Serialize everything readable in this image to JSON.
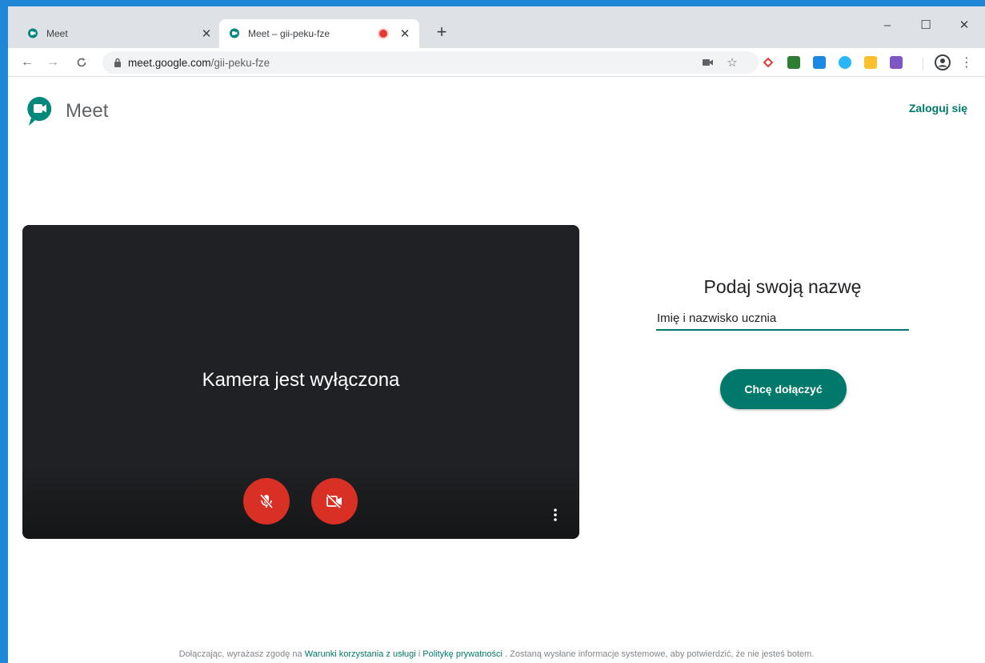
{
  "browser": {
    "tabs": [
      {
        "title": "Meet",
        "active": false
      },
      {
        "title": "Meet – gii-peku-fze",
        "active": true
      }
    ],
    "address": {
      "host": "meet.google.com",
      "path": "/gii-peku-fze"
    },
    "window_controls": {
      "minimize": "–",
      "maximize": "☐",
      "close": "✕"
    },
    "new_tab": "+"
  },
  "meet": {
    "brand": "Meet",
    "sign_in": "Zaloguj się",
    "preview": {
      "camera_status": "Kamera jest wyłączona",
      "mic_state": "off",
      "cam_state": "off"
    },
    "join": {
      "heading": "Podaj swoją nazwę",
      "name_value": "Imię i nazwisko ucznia",
      "button_label": "Chcę dołączyć"
    },
    "footer": {
      "prefix": "Dołączając, wyrażasz zgodę na",
      "terms": "Warunki korzystania z usługi",
      "and": "i",
      "privacy": "Politykę prywatności",
      "suffix": ". Zostaną wysłane informacje systemowe, aby potwierdzić, że nie jesteś botem."
    }
  },
  "colors": {
    "accent": "#00796b",
    "danger": "#d93025",
    "preview_bg": "#202124",
    "frame": "#1e88d6"
  },
  "icons": [
    "meet-favicon",
    "close-icon",
    "recording-dot-icon",
    "plus-icon",
    "back-icon",
    "forward-icon",
    "reload-icon",
    "lock-icon",
    "camera-blocked-icon",
    "star-icon",
    "profile-icon",
    "more-vert-icon",
    "mic-off-icon",
    "videocam-off-icon"
  ]
}
